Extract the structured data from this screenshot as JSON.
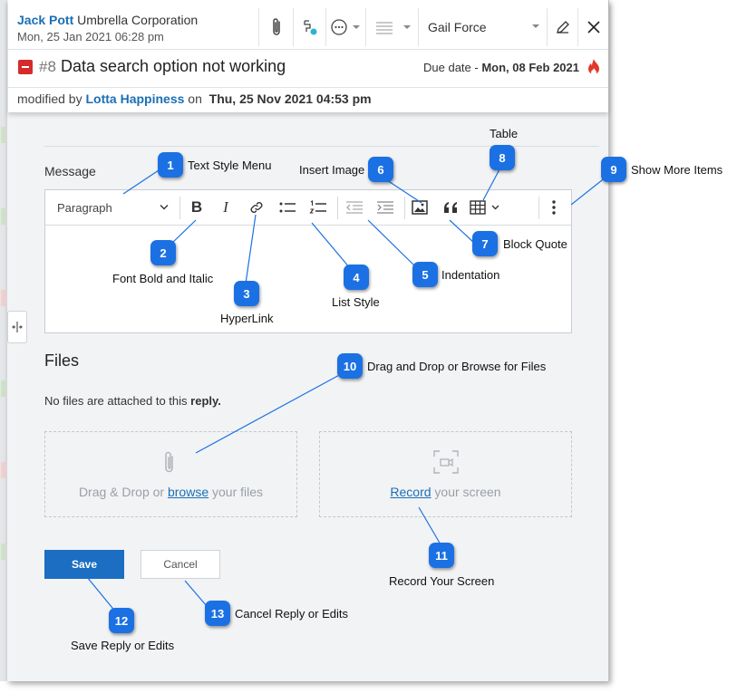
{
  "header": {
    "reporter_name": "Jack Pott",
    "reporter_company": "Umbrella Corporation",
    "created_at": "Mon, 25 Jan 2021 06:28 pm",
    "assignee": "Gail Force",
    "ticket_number": "#8",
    "ticket_title": "Data search option not working",
    "due_label": "Due date - ",
    "due_date": "Mon, 08 Feb 2021",
    "modified_prefix": "modified by",
    "modified_by": "Lotta Happiness",
    "modified_on_word": "on",
    "modified_at": "Thu, 25 Nov 2021 04:53 pm",
    "icons": [
      "paperclip-icon",
      "workflow-icon",
      "more-circle-icon",
      "status-lines-icon",
      "edit-icon",
      "close-icon",
      "fire-icon"
    ]
  },
  "editor": {
    "message_label": "Message",
    "paragraph_select": "Paragraph"
  },
  "files": {
    "heading": "Files",
    "none_text": "No files are attached to this ",
    "none_bold": "reply.",
    "drop_prefix": "Drag & Drop or ",
    "browse_link": "browse",
    "drop_suffix": " your files",
    "record_link": "Record",
    "record_suffix": " your screen"
  },
  "actions": {
    "save": "Save",
    "cancel": "Cancel"
  },
  "callouts": [
    {
      "num": "1",
      "label": "Text Style Menu"
    },
    {
      "num": "2",
      "label": "Font Bold and Italic"
    },
    {
      "num": "3",
      "label": "HyperLink"
    },
    {
      "num": "4",
      "label": "List Style"
    },
    {
      "num": "5",
      "label": "Indentation"
    },
    {
      "num": "6",
      "label": "Insert Image"
    },
    {
      "num": "7",
      "label": "Block Quote"
    },
    {
      "num": "8",
      "label": "Table"
    },
    {
      "num": "9",
      "label": "Show More Items"
    },
    {
      "num": "10",
      "label": "Drag and Drop or Browse for Files"
    },
    {
      "num": "11",
      "label": "Record Your Screen"
    },
    {
      "num": "12",
      "label": "Save Reply or Edits"
    },
    {
      "num": "13",
      "label": "Cancel Reply or Edits"
    }
  ],
  "colors": {
    "accent": "#1b6ec2",
    "callout_badge": "#1b71e3",
    "priority": "#d62b2b",
    "link": "#1a6fb5"
  }
}
